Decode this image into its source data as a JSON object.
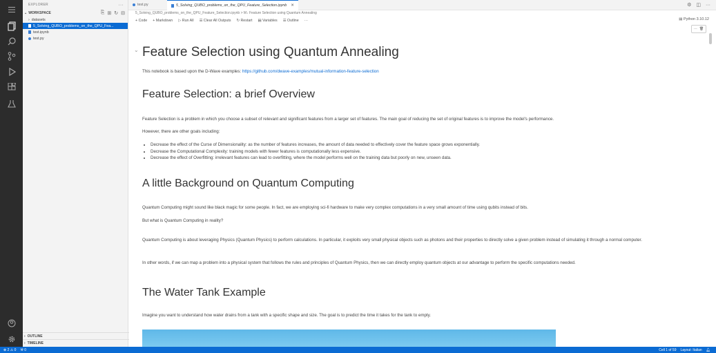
{
  "sidebar": {
    "explorer_title": "EXPLORER",
    "workspace_label": "WORKSPACE",
    "tree": [
      {
        "label": "datasets",
        "kind": "folder"
      },
      {
        "label": "5_Solving_QUBO_problems_on_the_QPU_Fea...",
        "kind": "notebook",
        "selected": true
      },
      {
        "label": "test.ipynb",
        "kind": "notebook"
      },
      {
        "label": "test.py",
        "kind": "python"
      }
    ],
    "outline_label": "OUTLINE",
    "timeline_label": "TIMELINE"
  },
  "tabs": [
    {
      "label": "test.py"
    },
    {
      "label": "5_Solving_QUBO_problems_on_the_QPU_Feature_Selection.ipynb",
      "active": true
    }
  ],
  "breadcrumb": "5_Solving_QUBO_problems_on_the_QPU_Feature_Selection.ipynb > M↓ Feature Selection using Quantum Annealing",
  "toolbar": {
    "code": "+ Code",
    "markdown": "+ Markdown",
    "run_all": "▷ Run All",
    "clear_outputs": "☰ Clear All Outputs",
    "restart": "↻ Restart",
    "variables": "▤ Variables",
    "outline": "☰ Outline",
    "more": "···"
  },
  "kernel": "Python 3.10.12",
  "notebook": {
    "title": "Feature Selection using Quantum Annealing",
    "intro_text": "This notebook is based upon the D-Wave examples: ",
    "intro_link": "https://github.com/dwave-examples/mutual-information-feature-selection",
    "h_overview": "Feature Selection: a brief Overview",
    "p_overview1": "Feature Selection is a problem in which you choose a subset of relevant and significant features from a larger set of features. The main goal of reducing the set of original features is to improve the model's performance.",
    "p_overview2": "However, there are other goals including:",
    "bullets": [
      "Decrease the effect of the Curse of Dimensionality: as the number of features increases, the amount of data needed to effectively cover the feature space grows exponentially.",
      "Decrease the Computational Complexity: training models with fewer features is computationally less expensive.",
      "Decrease the effect of Overfitting: irrelevant features can lead to overfitting, where the model performs well on the training data but poorly on new, unseen data."
    ],
    "h_background": "A little Background on Quantum Computing",
    "p_bg1": "Quantum Computing might sound like black magic for some people. In fact, we are employing sci-fi hardware to make very complex computations in a very small amount of time using qubits instead of bits.",
    "p_bg2": "But what is Quantum Computing in reality?",
    "p_bg3": "Quantum Computing is about leveraging Physics (Quantum Physics) to perform calculations. In particular, it exploits very small physical objects such as photons and their properties to directly solve a given problem instead of simulating it through a normal computer.",
    "p_bg4": "In other words, if we can map a problem into a physical system that follows the rules and principles of Quantum Physics, then we can directly employ quantum objects at our advantage to perform the specific computations needed.",
    "h_water": "The Water Tank Example",
    "p_water": "Imagine you want to understand how water drains from a tank with a specific shape and size. The goal is to predict the time it takes for the tank to empty."
  },
  "status": {
    "problems": "⊗ 2 ⚠ 0",
    "ports": "⚒ 0",
    "cell": "Cell 1 of 59",
    "layout": "Layout: Italian"
  },
  "colors": {
    "accent": "#0b6bd3",
    "activity_bar": "#2c2c2c",
    "sidebar": "#f3f3f3"
  }
}
